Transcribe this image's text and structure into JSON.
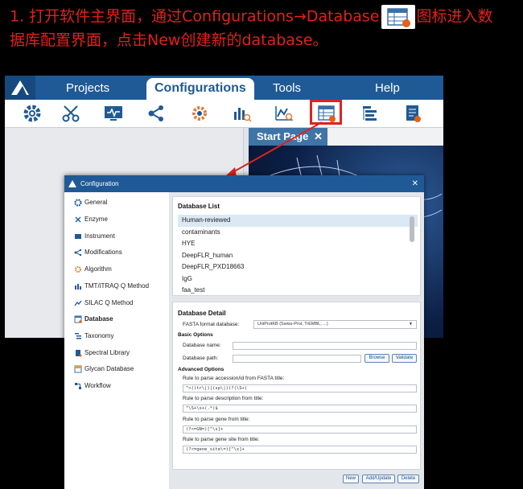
{
  "instruction": {
    "line1_before": "1. 打开软件主界面，通过Configurations→Database",
    "line1_after": "图标进入数",
    "line2": "据库配置界面，点击New创建新的database。",
    "inline_icon": "database-config-icon"
  },
  "app": {
    "menu": [
      "Projects",
      "Configurations",
      "Tools",
      "Help"
    ],
    "toolbar_icons": [
      "gear-icon",
      "scissors-icon",
      "monitor-icon",
      "network-icon",
      "settings-cog-icon",
      "bar-chart-search-icon",
      "line-chart-search-icon",
      "database-config-icon",
      "tree-list-icon",
      "report-icon"
    ],
    "tab_label": "Start Page",
    "tab_close": "✕"
  },
  "dialog": {
    "title": "Configuration",
    "close": "✕",
    "nav": [
      "General",
      "Enzyme",
      "Instrument",
      "Modifications",
      "Algorithm",
      "TMT/iTRAQ Q Method",
      "SILAC Q Method",
      "Database",
      "Taxonomy",
      "Spectral Library",
      "Glycan Database",
      "Workflow"
    ],
    "active_nav": "Database",
    "db_list_title": "Database List",
    "db_list": [
      "Human-reviewed",
      "contaminants",
      "HYE",
      "DeepFLR_human",
      "DeepFLR_PXD18663",
      "IgG",
      "faa_test"
    ],
    "db_detail_title": "Database Detail",
    "fasta_label": "FASTA format database:",
    "fasta_value": "UniProtKB (Swiss-Prot, TrEMBL, ...)",
    "basic_options": "Basic Options",
    "db_name_label": "Database name:",
    "db_name_value": "",
    "db_path_label": "Database path:",
    "db_path_value": "",
    "browse": "Browse",
    "validate": "Validate",
    "advanced_options": "Advanced Options",
    "rule_acc_label": "Rule to parse accession/id from FASTA title:",
    "rule_acc_value": "^>((tr\\|)|(sp\\|))?(\\S+)",
    "rule_desc_label": "Rule to parse description from title:",
    "rule_desc_value": "^\\S+\\s+(.*)$",
    "rule_gene_label": "Rule to parse gene from title:",
    "rule_gene_value": "(?<=GN=)[^\\s]+",
    "rule_site_label": "Rule to parse gene site from title:",
    "rule_site_value": "(?<=gene_site\\=)[^\\s]+",
    "new": "New",
    "add_update": "Add/Update",
    "delete": "Delete"
  }
}
